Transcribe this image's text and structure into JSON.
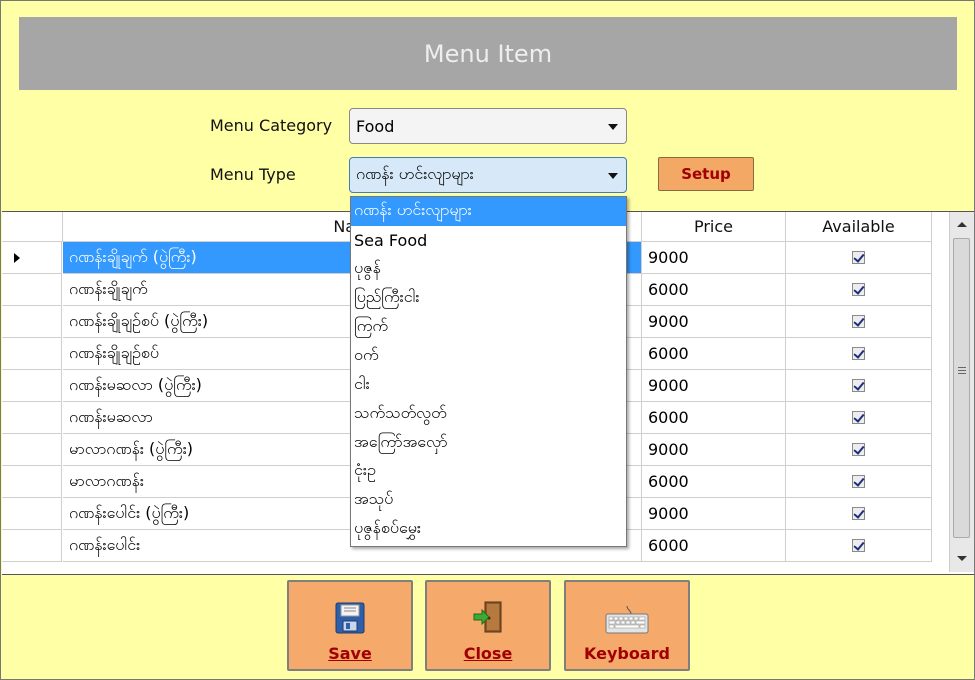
{
  "header": {
    "title": "Menu Item"
  },
  "form": {
    "category_label": "Menu Category",
    "category_value": "Food",
    "type_label": "Menu Type",
    "type_value": "ဂဏန်း ဟင်းလျာများ",
    "setup_label": "Setup"
  },
  "grid": {
    "columns": [
      "Name",
      "Price",
      "Available"
    ],
    "visible_header_name": "Nam",
    "rows": [
      {
        "name": "ဂဏန်းချိုချက် (ပွဲကြီး)",
        "price": "9000",
        "available": true
      },
      {
        "name": "ဂဏန်းချိုချက်",
        "price": "6000",
        "available": true
      },
      {
        "name": "ဂဏန်းချိုချဉ်စပ် (ပွဲကြီး)",
        "price": "9000",
        "available": true
      },
      {
        "name": "ဂဏန်းချိုချဉ်စပ်",
        "price": "6000",
        "available": true
      },
      {
        "name": "ဂဏန်းမဆလာ (ပွဲကြီး)",
        "price": "9000",
        "available": true
      },
      {
        "name": "ဂဏန်းမဆလာ",
        "price": "6000",
        "available": true
      },
      {
        "name": "မာလာဂဏန်း (ပွဲကြီး)",
        "price": "9000",
        "available": true
      },
      {
        "name": "မာလာဂဏန်း",
        "price": "6000",
        "available": true
      },
      {
        "name": "ဂဏန်းပေါင်း (ပွဲကြီး)",
        "price": "9000",
        "available": true
      },
      {
        "name": "ဂဏန်းပေါင်း",
        "price": "6000",
        "available": true
      }
    ],
    "selected_row": 0
  },
  "dropdown": {
    "options": [
      "ဂဏန်း ဟင်းလျာများ",
      "Sea Food",
      "ပုဇွန်",
      "ပြည်ကြီးငါး",
      "ကြက်",
      "ဝက်",
      "ငါး",
      "သက်သတ်လွတ်",
      "အကြော်အလှော်",
      "ငုံးဥ",
      "အသုပ်",
      "ပုဇွန်စပ်မွှေး"
    ],
    "selected": 0
  },
  "actions": {
    "save_label": "Save",
    "close_label": "Close",
    "keyboard_label": "Keyboard"
  },
  "colors": {
    "background": "#FFFFA6",
    "title_bar": "#A6A6A6",
    "button": "#F5A96A",
    "button_text": "#A00000",
    "selection": "#3399FF"
  },
  "icons": {
    "save": "floppy-disk-icon",
    "close": "door-exit-icon",
    "keyboard": "keyboard-icon"
  }
}
